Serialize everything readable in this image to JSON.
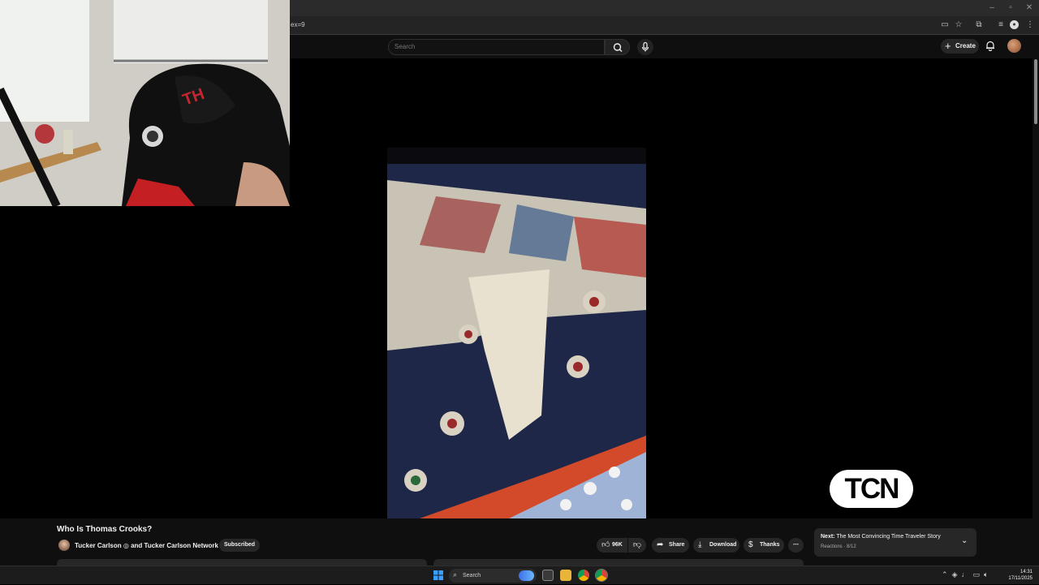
{
  "browser": {
    "url_fragment": "ex=9",
    "window_controls": [
      "minimize",
      "maximize",
      "close"
    ]
  },
  "header": {
    "search_placeholder": "Search",
    "create_label": "Create",
    "icons": [
      "search-icon",
      "mic-icon",
      "plus-icon",
      "bell-icon",
      "avatar"
    ]
  },
  "player": {
    "overlay_logo_text": "TCN"
  },
  "video": {
    "title": "Who Is Thomas Crooks?",
    "channel": "Tucker Carlson ◎ and Tucker Carlson Network",
    "subscribed_label": "Subscribed"
  },
  "actions": {
    "likes": "96K",
    "share": "Share",
    "download": "Download",
    "thanks": "Thanks"
  },
  "next": {
    "prefix": "Next:",
    "title": "The Most Convincing Time Traveler Story",
    "playlist": "Reactions · 8/12"
  },
  "taskbar": {
    "search_label": "Search",
    "time": "14:31",
    "date": "17/11/2025"
  },
  "colors": {
    "background": "#0f0f0f",
    "chip": "#272727",
    "text": "#f1f1f1"
  }
}
